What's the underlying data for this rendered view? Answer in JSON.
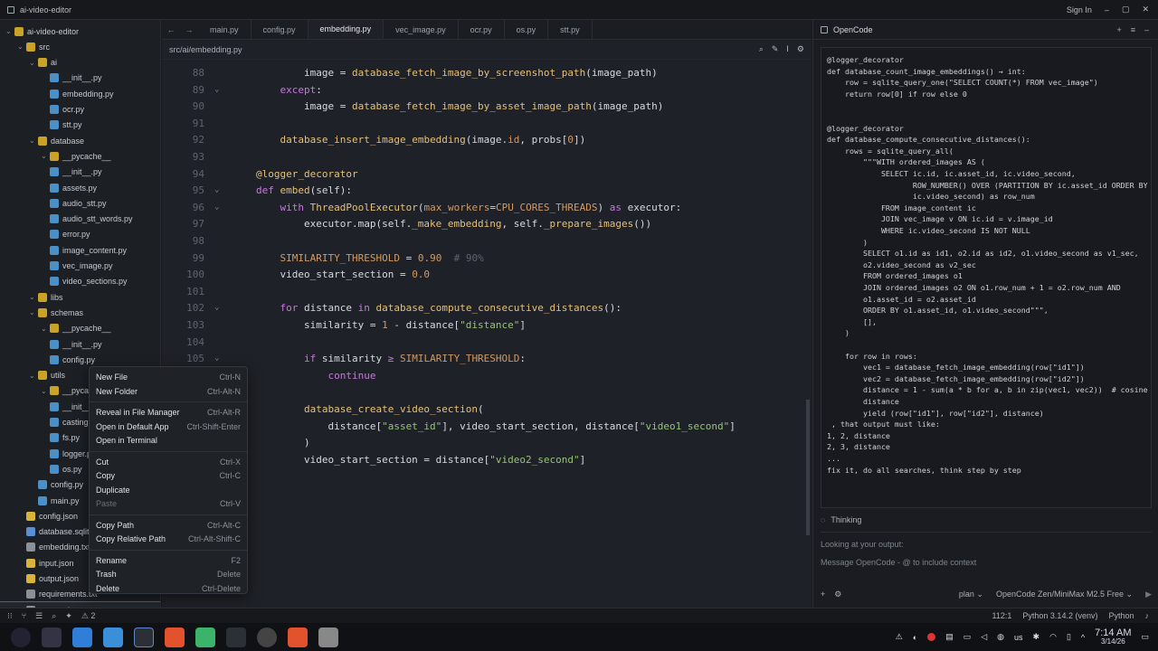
{
  "window": {
    "title": "ai-video-editor",
    "signin": "Sign In"
  },
  "tabs": [
    "main.py",
    "config.py",
    "embedding.py",
    "vec_image.py",
    "ocr.py",
    "os.py",
    "stt.py"
  ],
  "breadcrumb": "src/ai/embedding.py",
  "tree": [
    {
      "label": "ai-video-editor",
      "d": 0,
      "k": "dir"
    },
    {
      "label": "src",
      "d": 1,
      "k": "dir"
    },
    {
      "label": "ai",
      "d": 2,
      "k": "dir"
    },
    {
      "label": "__init__.py",
      "d": 3,
      "k": "py"
    },
    {
      "label": "embedding.py",
      "d": 3,
      "k": "py"
    },
    {
      "label": "ocr.py",
      "d": 3,
      "k": "py"
    },
    {
      "label": "stt.py",
      "d": 3,
      "k": "py"
    },
    {
      "label": "database",
      "d": 2,
      "k": "dir"
    },
    {
      "label": "__pycache__",
      "d": 3,
      "k": "dir"
    },
    {
      "label": "__init__.py",
      "d": 3,
      "k": "py"
    },
    {
      "label": "assets.py",
      "d": 3,
      "k": "py"
    },
    {
      "label": "audio_stt.py",
      "d": 3,
      "k": "py"
    },
    {
      "label": "audio_stt_words.py",
      "d": 3,
      "k": "py"
    },
    {
      "label": "error.py",
      "d": 3,
      "k": "py"
    },
    {
      "label": "image_content.py",
      "d": 3,
      "k": "py"
    },
    {
      "label": "vec_image.py",
      "d": 3,
      "k": "py"
    },
    {
      "label": "video_sections.py",
      "d": 3,
      "k": "py"
    },
    {
      "label": "libs",
      "d": 2,
      "k": "dir"
    },
    {
      "label": "schemas",
      "d": 2,
      "k": "dir"
    },
    {
      "label": "__pycache__",
      "d": 3,
      "k": "dir"
    },
    {
      "label": "__init__.py",
      "d": 3,
      "k": "py"
    },
    {
      "label": "config.py",
      "d": 3,
      "k": "py"
    },
    {
      "label": "utils",
      "d": 2,
      "k": "dir"
    },
    {
      "label": "__pycache__",
      "d": 3,
      "k": "dir"
    },
    {
      "label": "__init__.py",
      "d": 3,
      "k": "py"
    },
    {
      "label": "casting.py",
      "d": 3,
      "k": "py"
    },
    {
      "label": "fs.py",
      "d": 3,
      "k": "py"
    },
    {
      "label": "logger.py",
      "d": 3,
      "k": "py"
    },
    {
      "label": "os.py",
      "d": 3,
      "k": "py"
    },
    {
      "label": "config.py",
      "d": 2,
      "k": "py"
    },
    {
      "label": "main.py",
      "d": 2,
      "k": "py"
    },
    {
      "label": "config.json",
      "d": 1,
      "k": "json"
    },
    {
      "label": "database.sqlite",
      "d": 1,
      "k": "db"
    },
    {
      "label": "embedding.txt",
      "d": 1,
      "k": "txt"
    },
    {
      "label": "input.json",
      "d": 1,
      "k": "json"
    },
    {
      "label": "output.json",
      "d": 1,
      "k": "json"
    },
    {
      "label": "requirements.txt",
      "d": 1,
      "k": "txt"
    },
    {
      "label": "test.mp4",
      "d": 1,
      "k": "txt"
    }
  ],
  "code": [
    {
      "n": "88",
      "f": "",
      "h": "        image = <span class='fn'>database_fetch_image_by_screenshot_path</span>(image_path)"
    },
    {
      "n": "89",
      "f": "⌄",
      "h": "    <span class='kw'>except</span>:"
    },
    {
      "n": "90",
      "f": "",
      "h": "        image = <span class='fn'>database_fetch_image_by_asset_image_path</span>(image_path)"
    },
    {
      "n": "91",
      "f": "",
      "h": ""
    },
    {
      "n": "92",
      "f": "",
      "h": "    <span class='fn'>database_insert_image_embedding</span>(image.<span class='de'>id</span>, probs[<span class='nu'>0</span>])"
    },
    {
      "n": "93",
      "f": "",
      "h": ""
    },
    {
      "n": "94",
      "f": "",
      "h": "<span class='fn'>@logger_decorator</span>"
    },
    {
      "n": "95",
      "f": "⌄",
      "h": "<span class='kw'>def</span> <span class='fn'>embed</span>(self):"
    },
    {
      "n": "96",
      "f": "⌄",
      "h": "    <span class='kw'>with</span> <span class='fn'>ThreadPoolExecutor</span>(<span class='de'>max_workers</span>=<span class='nu'>CPU_CORES_THREADS</span>) <span class='kw'>as</span> executor:"
    },
    {
      "n": "97",
      "f": "",
      "h": "        executor.map(self.<span class='fn'>_make_embedding</span>, self.<span class='fn'>_prepare_images</span>())"
    },
    {
      "n": "98",
      "f": "",
      "h": ""
    },
    {
      "n": "99",
      "f": "",
      "h": "    <span class='nu'>SIMILARITY_THRESHOLD</span> = <span class='nu'>0.90</span>  <span class='cm'># 90%</span>"
    },
    {
      "n": "100",
      "f": "",
      "h": "    video_start_section = <span class='nu'>0.0</span>"
    },
    {
      "n": "101",
      "f": "",
      "h": ""
    },
    {
      "n": "102",
      "f": "⌄",
      "h": "    <span class='kw'>for</span> distance <span class='kw'>in</span> <span class='fn'>database_compute_consecutive_distances</span>():"
    },
    {
      "n": "103",
      "f": "",
      "h": "        similarity = <span class='nu'>1</span> - distance[<span class='st'>\"distance\"</span>]"
    },
    {
      "n": "104",
      "f": "",
      "h": ""
    },
    {
      "n": "105",
      "f": "⌄",
      "h": "        <span class='kw'>if</span> similarity <span class='pu'>≥</span> <span class='nu'>SIMILARITY_THRESHOLD</span>:"
    },
    {
      "n": "106",
      "f": "",
      "h": "            <span class='kw'>continue</span>"
    },
    {
      "n": "107",
      "f": "",
      "h": ""
    },
    {
      "n": "108",
      "f": "⌄",
      "h": "        <span class='fn'>database_create_video_section</span>("
    },
    {
      "n": "109",
      "f": "",
      "h": "            distance[<span class='st'>\"asset_id\"</span>], video_start_section, distance[<span class='st'>\"video1_second\"</span>]"
    },
    {
      "n": "110",
      "f": "",
      "h": "        )"
    },
    {
      "n": "111",
      "f": "",
      "h": "        video_start_section = distance[<span class='st'>\"video2_second\"</span>]"
    },
    {
      "n": "112",
      "f": "",
      "h": ""
    }
  ],
  "panel": {
    "title": "OpenCode",
    "thinking": "Thinking",
    "looking": "Looking at your output:",
    "placeholder": "Message OpenCode - @ to include context",
    "mode": "plan",
    "model": "OpenCode Zen/MiniMax M2.5 Free"
  },
  "chat": [
    "@logger_decorator",
    "def database_count_image_embeddings() → int:",
    "    row = sqlite_query_one(\"SELECT COUNT(*) FROM vec_image\")",
    "    return row[0] if row else 0",
    "",
    "",
    "@logger_decorator",
    "def database_compute_consecutive_distances():",
    "    rows = sqlite_query_all(",
    "        \"\"\"WITH ordered_images AS (",
    "            SELECT ic.id, ic.asset_id, ic.video_second,",
    "                   ROW_NUMBER() OVER (PARTITION BY ic.asset_id ORDER BY",
    "                   ic.video_second) as row_num",
    "            FROM image_content ic",
    "            JOIN vec_image v ON ic.id = v.image_id",
    "            WHERE ic.video_second IS NOT NULL",
    "        )",
    "        SELECT o1.id as id1, o2.id as id2, o1.video_second as v1_sec,",
    "        o2.video_second as v2_sec",
    "        FROM ordered_images o1",
    "        JOIN ordered_images o2 ON o1.row_num + 1 = o2.row_num AND",
    "        o1.asset_id = o2.asset_id",
    "        ORDER BY o1.asset_id, o1.video_second\"\"\",",
    "        [],",
    "    )",
    "",
    "    for row in rows:",
    "        vec1 = database_fetch_image_embedding(row[\"id1\"])",
    "        vec2 = database_fetch_image_embedding(row[\"id2\"])",
    "        distance = 1 - sum(a * b for a, b in zip(vec1, vec2))  # cosine",
    "        distance",
    "        yield (row[\"id1\"], row[\"id2\"], distance)",
    " , that output must like:",
    "1, 2, distance",
    "2, 3, distance",
    "...",
    "fix it, do all searches, think step by step"
  ],
  "menu": [
    {
      "label": "New File",
      "sc": "Ctrl-N"
    },
    {
      "label": "New Folder",
      "sc": "Ctrl-Alt-N"
    },
    {
      "label": "Reveal in File Manager",
      "sc": "Ctrl-Alt-R"
    },
    {
      "label": "Open in Default App",
      "sc": "Ctrl-Shift-Enter"
    },
    {
      "label": "Open in Terminal",
      "sc": ""
    },
    {
      "label": "Cut",
      "sc": "Ctrl-X"
    },
    {
      "label": "Copy",
      "sc": "Ctrl-C"
    },
    {
      "label": "Duplicate",
      "sc": ""
    },
    {
      "label": "Paste",
      "sc": "Ctrl-V"
    },
    {
      "label": "Copy Path",
      "sc": "Ctrl-Alt-C"
    },
    {
      "label": "Copy Relative Path",
      "sc": "Ctrl-Alt-Shift-C"
    },
    {
      "label": "Rename",
      "sc": "F2"
    },
    {
      "label": "Trash",
      "sc": "Delete"
    },
    {
      "label": "Delete",
      "sc": "Ctrl-Delete"
    }
  ],
  "status": {
    "warnings": "2",
    "pos": "112:1",
    "python": "Python 3.14.2 (venv)",
    "lang": "Python"
  },
  "taskbar": {
    "time": "7:14 AM",
    "date": "3/14/26",
    "kb": "us"
  },
  "colors": {
    "accent": "#3b5bdb",
    "folder": "#c9a227",
    "python": "#4a90c8",
    "json": "#d8b43a"
  }
}
